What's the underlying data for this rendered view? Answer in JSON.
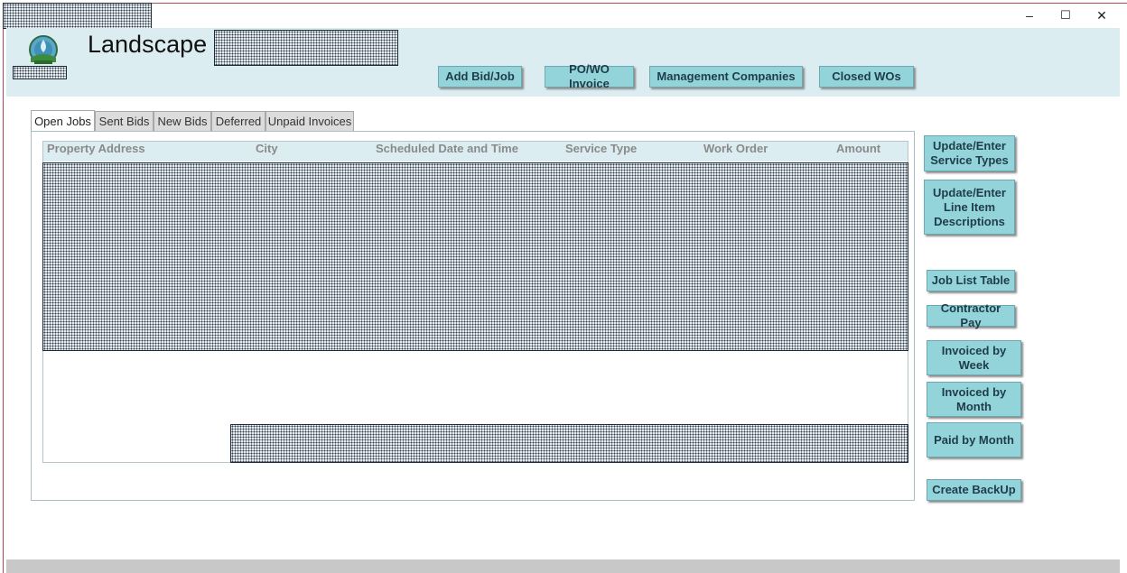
{
  "window": {
    "minimize_symbol": "–",
    "maximize_symbol": "☐",
    "close_symbol": "✕"
  },
  "header": {
    "title": "Landscape",
    "buttons": {
      "add_bid": "Add Bid/Job",
      "po_invoice": "PO/WO Invoice",
      "mgmt": "Management Companies",
      "closed": "Closed WOs"
    }
  },
  "tabs": [
    "Open Jobs",
    "Sent Bids",
    "New Bids",
    "Deferred",
    "Unpaid Invoices"
  ],
  "table": {
    "columns": [
      "Property Address",
      "City",
      "Scheduled Date and Time",
      "Service Type",
      "Work Order",
      "Amount"
    ]
  },
  "side_buttons": {
    "service_types": "Update/Enter Service Types",
    "line_items": "Update/Enter Line Item Descriptions",
    "job_list": "Job List Table",
    "contractor_pay": "Contractor Pay",
    "invoiced_week": "Invoiced by Week",
    "invoiced_month": "Invoiced by Month",
    "paid_month": "Paid by Month",
    "backup": "Create BackUp"
  },
  "colors": {
    "header_bg": "#dcedf1",
    "button_bg": "#93d4db",
    "button_text": "#1f3c48"
  }
}
